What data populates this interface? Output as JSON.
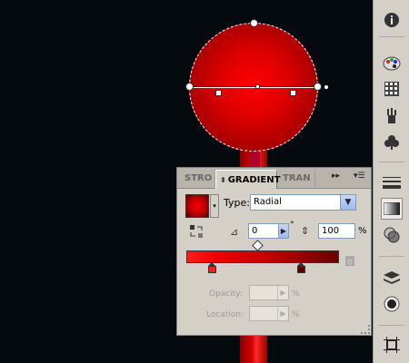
{
  "panel": {
    "tabs": [
      "STRO",
      "GRADIENT",
      "TRAN"
    ],
    "active_tab": "GRADIENT",
    "collapse_glyph": "▸▸",
    "menu_glyph": "▾☰",
    "type_label": "Type:",
    "type_value": "Radial",
    "angle_value": "0",
    "angle_unit": "°",
    "aspect_value": "100",
    "aspect_unit": "%",
    "opacity_label": "Opacity:",
    "opacity_unit": "%",
    "location_label": "Location:",
    "location_unit": "%",
    "gradient_colors": [
      "#ff1a1a",
      "#6a0000"
    ],
    "midpoint_position": 0.47,
    "stops": [
      {
        "position": 0.17,
        "color": "#ff1a1a"
      },
      {
        "position": 0.76,
        "color": "#5a0000"
      }
    ]
  },
  "toolstrip": {
    "icons": [
      "info-icon",
      "color-palette-icon",
      "swatches-icon",
      "brushes-icon",
      "symbols-icon",
      "stroke-icon",
      "gradient-icon",
      "transparency-icon",
      "layers-icon",
      "appearance-icon",
      "artboard-icon"
    ]
  },
  "artwork": {
    "circle_colors": [
      "#ff0000",
      "#5a0000"
    ],
    "background": "#050a0f"
  }
}
